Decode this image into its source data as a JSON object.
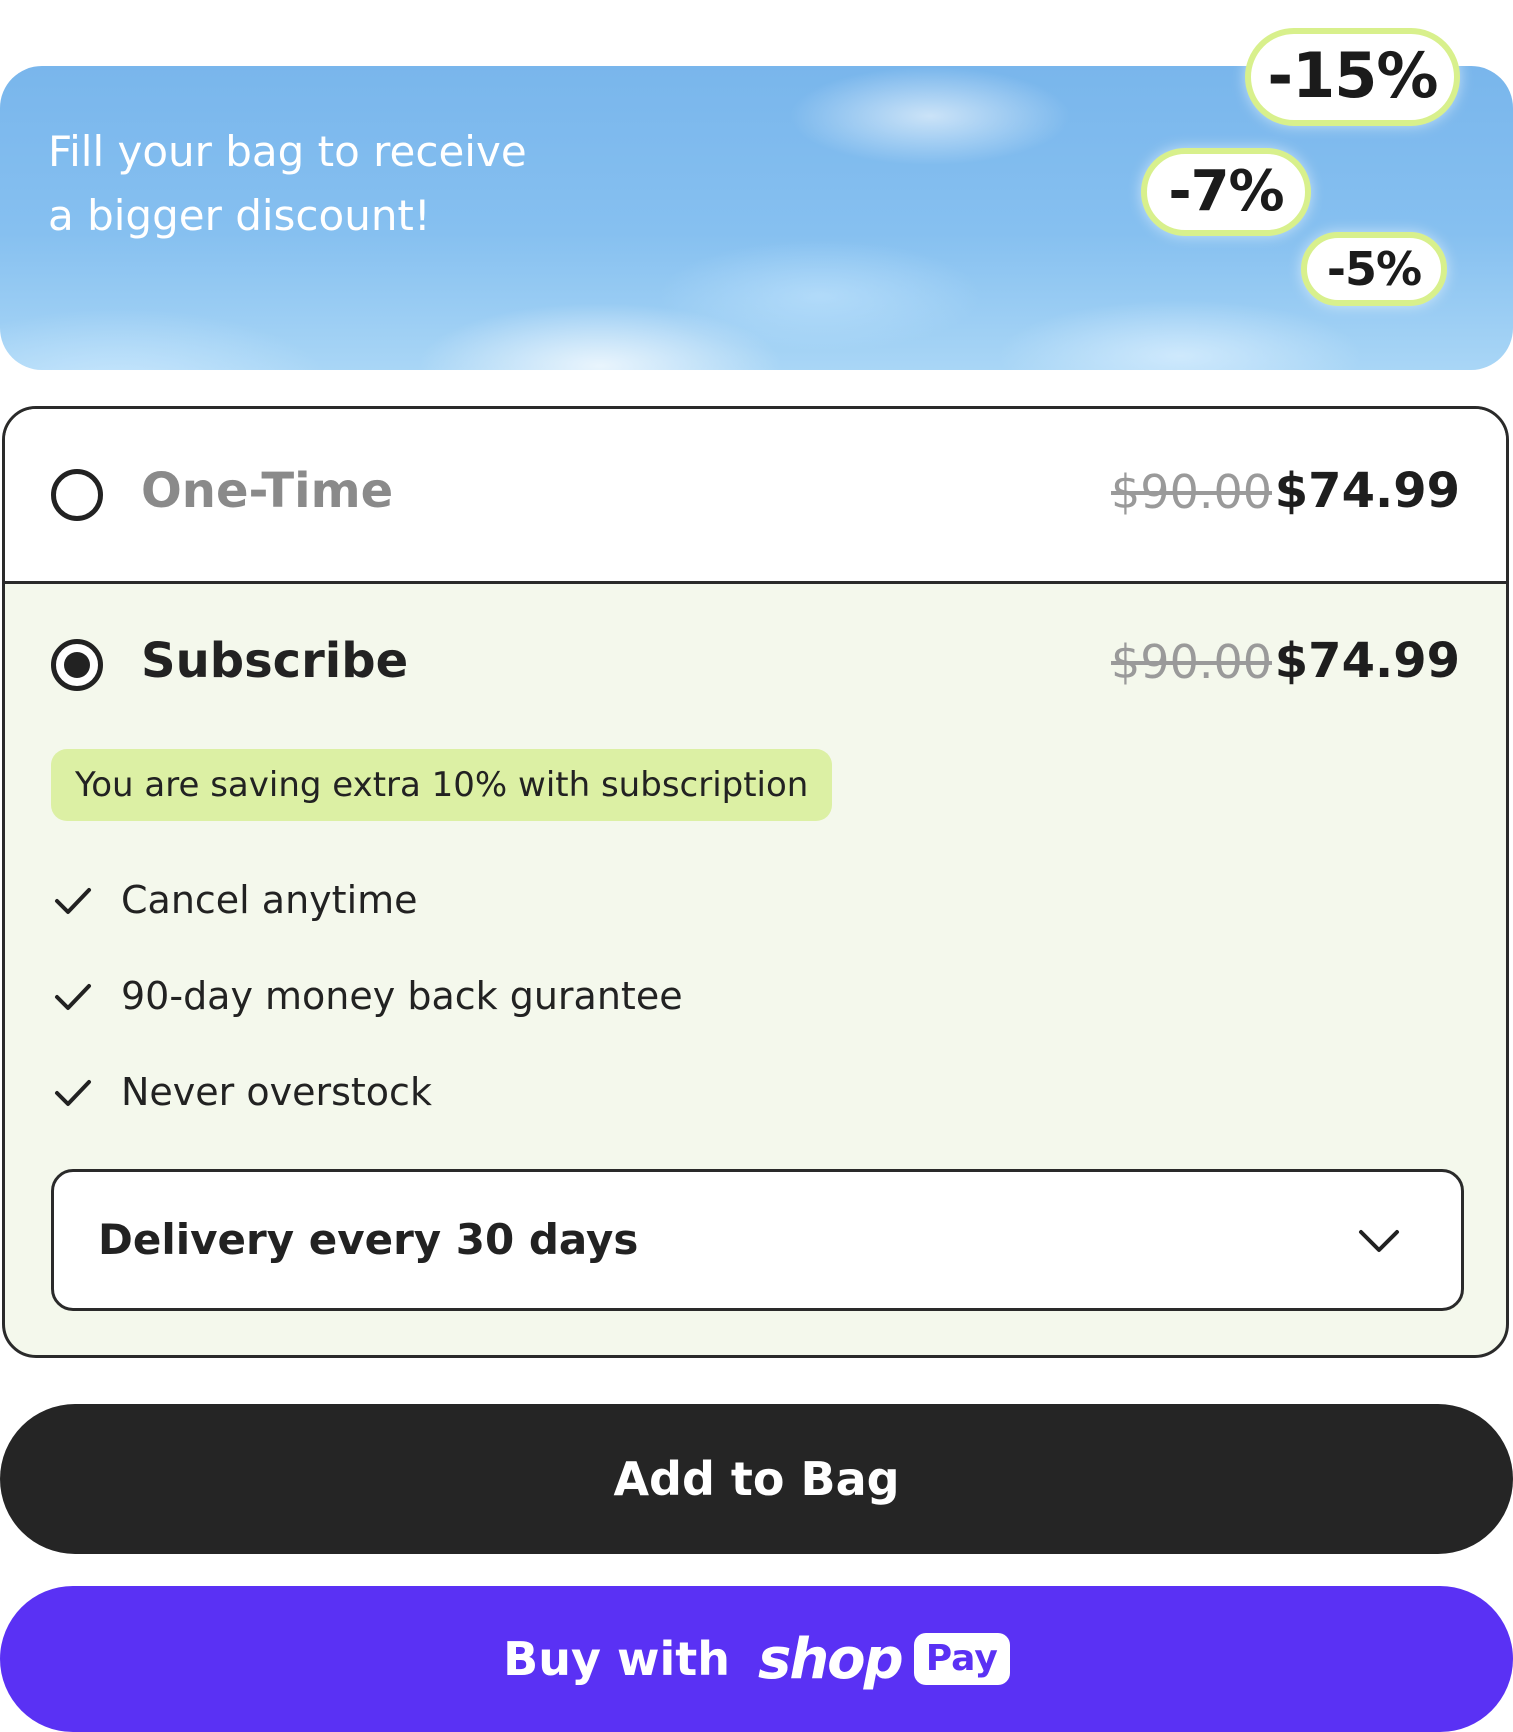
{
  "banner": {
    "line1": "Fill your bag to receive",
    "line2": "a bigger discount!",
    "discounts": [
      "-15%",
      "-7%",
      "-5%"
    ],
    "pill_border_color": "#d8f08c"
  },
  "options": {
    "one_time": {
      "label": "One-Time",
      "old_price": "$90.00",
      "new_price": "$74.99",
      "selected": false
    },
    "subscribe": {
      "label": "Subscribe",
      "old_price": "$90.00",
      "new_price": "$74.99",
      "selected": true,
      "saving_badge": "You are saving extra 10% with subscription",
      "benefits": [
        {
          "icon": "check-icon",
          "text": "Cancel anytime"
        },
        {
          "icon": "check-icon",
          "text": "90-day money back gurantee"
        },
        {
          "icon": "check-icon",
          "text": "Never overstock"
        }
      ],
      "delivery": {
        "selected_value": "Delivery every 30 days",
        "icon": "chevron-down-icon"
      }
    }
  },
  "actions": {
    "add_to_bag": "Add to Bag",
    "buy_with": "Buy with",
    "shop_word": "shop",
    "pay_word": "Pay"
  },
  "colors": {
    "subscribe_bg": "#f4f8ec",
    "saving_badge_bg": "#dcf0a4",
    "add_button_bg": "#252525",
    "shop_pay_purple": "#5a31f4"
  }
}
